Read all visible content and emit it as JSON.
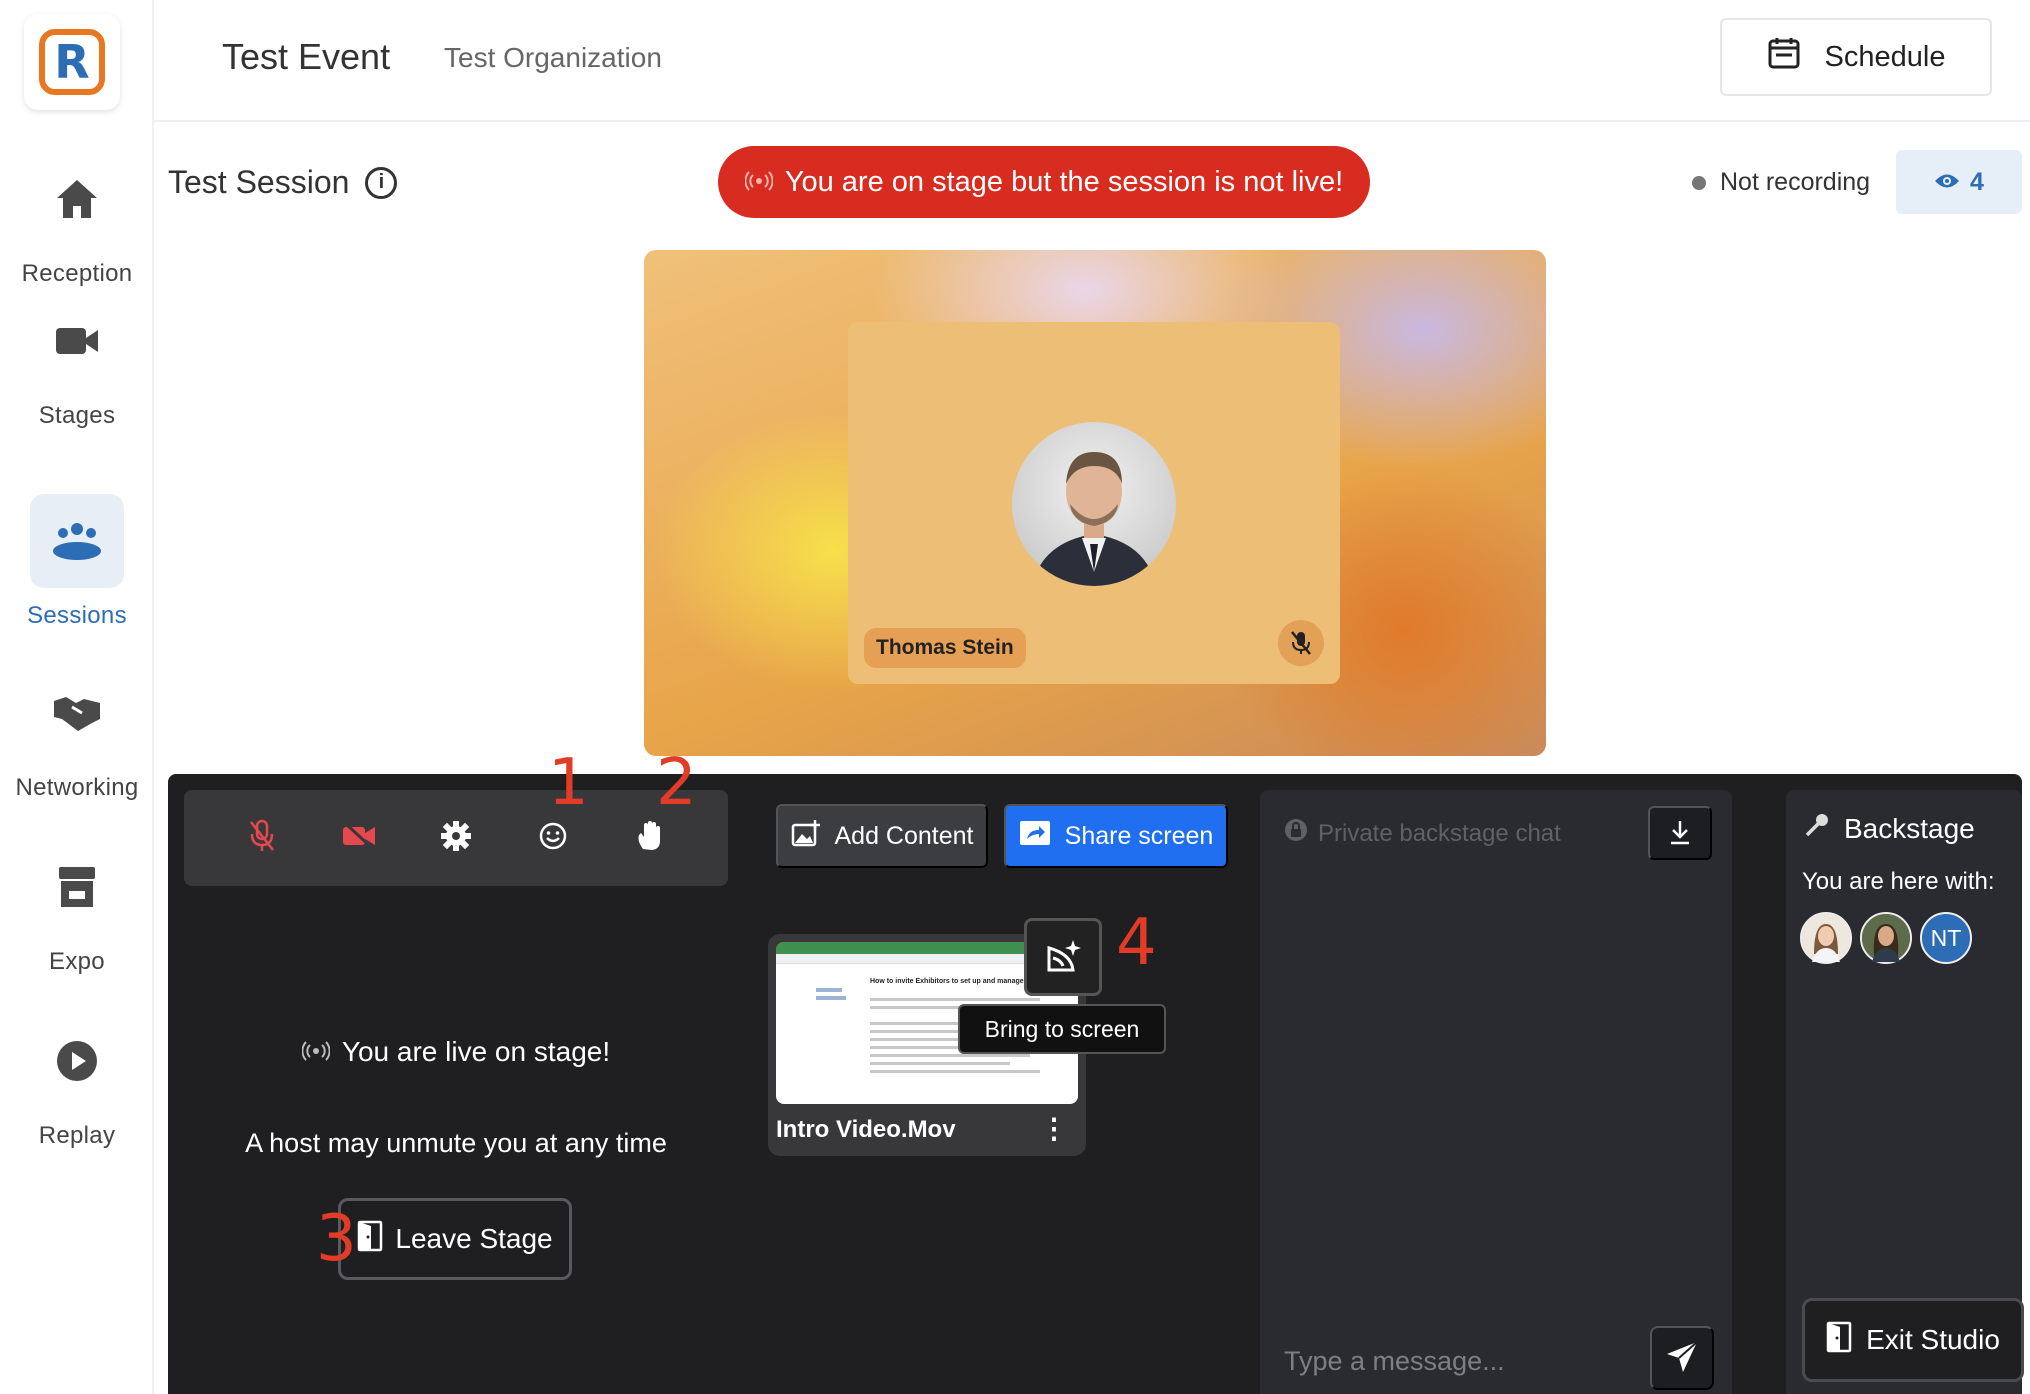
{
  "app": {
    "logo_letter": "R",
    "logo_colors": {
      "ring": "#e87722",
      "letter": "#2d6db5"
    }
  },
  "sidebar": {
    "items": [
      {
        "label": "Reception",
        "icon": "home-icon",
        "active": false
      },
      {
        "label": "Stages",
        "icon": "video-camera-icon",
        "active": false
      },
      {
        "label": "Sessions",
        "icon": "group-icon",
        "active": true
      },
      {
        "label": "Networking",
        "icon": "handshake-icon",
        "active": false
      },
      {
        "label": "Expo",
        "icon": "storefront-icon",
        "active": false
      },
      {
        "label": "Replay",
        "icon": "play-circle-icon",
        "active": false
      }
    ]
  },
  "header": {
    "event_title": "Test Event",
    "organization": "Test Organization",
    "schedule_label": "Schedule"
  },
  "session": {
    "title": "Test Session",
    "alert": "You are on stage but the session is not live!",
    "recording_status": "Not recording",
    "viewer_count": "4"
  },
  "stage": {
    "participant_name": "Thomas Stein",
    "participant_muted": true
  },
  "studio": {
    "controls": [
      {
        "icon": "mic-off-icon",
        "color": "#e5484d"
      },
      {
        "icon": "camera-off-icon",
        "color": "#e5484d"
      },
      {
        "icon": "gear-icon",
        "color": "#ffffff"
      },
      {
        "icon": "emoji-icon",
        "color": "#ffffff"
      },
      {
        "icon": "raise-hand-icon",
        "color": "#ffffff"
      }
    ],
    "annotations": {
      "a1": "1",
      "a2": "2",
      "a3": "3",
      "a4": "4"
    },
    "add_content_label": "Add Content",
    "share_screen_label": "Share screen",
    "live_message": "You are live on stage!",
    "unmute_message": "A host may unmute you at any time",
    "leave_stage_label": "Leave Stage",
    "media": {
      "name": "Intro Video.Mov",
      "thumbnail_heading": "How to invite Exhibitors to set up and manage an Expo B..."
    },
    "bring_to_screen_tooltip": "Bring to screen"
  },
  "chat": {
    "title": "Private backstage chat",
    "input_placeholder": "Type a message..."
  },
  "backstage": {
    "title": "Backstage",
    "subtitle": "You are here with:",
    "avatars": [
      {
        "initials": "",
        "color": "#d8c2a8"
      },
      {
        "initials": "",
        "color": "#6b5a48"
      },
      {
        "initials": "NT",
        "color": "#2d6db5"
      }
    ],
    "exit_label": "Exit Studio"
  },
  "colors": {
    "brand": "#2d6db5",
    "alert": "#d92c20",
    "share": "#1f6ff0",
    "annotation": "#e23b26"
  }
}
